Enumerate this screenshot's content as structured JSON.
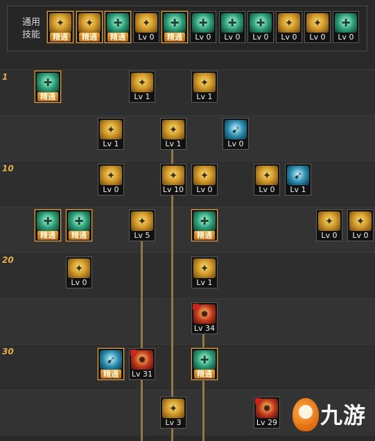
{
  "common": {
    "label_line1": "通用",
    "label_line2": "技能",
    "skills": [
      {
        "icon": "sit-fighter-icon",
        "color": "gold",
        "level": "精通",
        "mastered": true
      },
      {
        "icon": "crouch-fighter-icon",
        "color": "gold",
        "level": "精通",
        "mastered": true
      },
      {
        "icon": "dash-fighter-icon",
        "color": "teal",
        "level": "精通",
        "mastered": true
      },
      {
        "icon": "wings-icon",
        "color": "gold",
        "level": "Lv 0",
        "mastered": false
      },
      {
        "icon": "target-icon",
        "color": "teal",
        "level": "精通",
        "mastered": true
      },
      {
        "icon": "crosshair-icon",
        "color": "teal",
        "level": "Lv 0",
        "mastered": false
      },
      {
        "icon": "shout-icon",
        "color": "teal",
        "level": "Lv 0",
        "mastered": false
      },
      {
        "icon": "gear-head-icon",
        "color": "teal",
        "level": "Lv 0",
        "mastered": false
      },
      {
        "icon": "eye-swirl-icon",
        "color": "gold",
        "level": "Lv 0",
        "mastered": false
      },
      {
        "icon": "power-up-icon",
        "color": "gold",
        "level": "Lv 0",
        "mastered": false
      },
      {
        "icon": "leap-icon",
        "color": "teal",
        "level": "Lv 0",
        "mastered": false
      }
    ]
  },
  "tree": {
    "level_labels": [
      {
        "text": "1",
        "row": 0
      },
      {
        "text": "10",
        "row": 2
      },
      {
        "text": "20",
        "row": 4
      },
      {
        "text": "30",
        "row": 6
      }
    ],
    "skills": [
      {
        "icon": "cross-blades-icon",
        "color": "teal",
        "level": "精通",
        "mastered": true
      },
      {
        "icon": "boomerang-icon",
        "color": "gold",
        "level": "Lv 1",
        "mastered": false
      },
      {
        "icon": "kick-icon",
        "color": "gold",
        "level": "Lv 1",
        "mastered": false
      },
      {
        "icon": "burst-icon",
        "color": "gold",
        "level": "Lv 1",
        "mastered": false
      },
      {
        "icon": "shotgun-blast-icon",
        "color": "gold",
        "level": "Lv 1",
        "mastered": false
      },
      {
        "icon": "gun-icon",
        "color": "cyan",
        "level": "Lv 0",
        "mastered": false
      },
      {
        "icon": "fire-slash-icon",
        "color": "gold",
        "level": "Lv 0",
        "mastered": false
      },
      {
        "icon": "explosion-icon",
        "color": "gold",
        "level": "Lv 10",
        "mastered": false
      },
      {
        "icon": "stab-icon",
        "color": "gold",
        "level": "Lv 0",
        "mastered": false
      },
      {
        "icon": "upload-icon",
        "color": "gold",
        "level": "Lv 0",
        "mastered": false
      },
      {
        "icon": "spread-arrow-icon",
        "color": "cyan",
        "level": "Lv 1",
        "mastered": false
      },
      {
        "icon": "rifle-icon",
        "color": "teal",
        "level": "精通",
        "mastered": true
      },
      {
        "icon": "drill-icon",
        "color": "teal",
        "level": "精通",
        "mastered": true
      },
      {
        "icon": "cannon-icon",
        "color": "gold",
        "level": "Lv 5",
        "mastered": false
      },
      {
        "icon": "blade-icon",
        "color": "teal",
        "level": "精通",
        "mastered": true
      },
      {
        "icon": "axe-icon",
        "color": "gold",
        "level": "Lv 0",
        "mastered": false
      },
      {
        "icon": "grenade-icon",
        "color": "gold",
        "level": "Lv 0",
        "mastered": false
      },
      {
        "icon": "fist-beam-icon",
        "color": "gold",
        "level": "Lv 0",
        "mastered": false
      },
      {
        "icon": "eye-blast-icon",
        "color": "gold",
        "level": "Lv 1",
        "mastered": false
      },
      {
        "icon": "heavy-cannon-icon",
        "color": "red",
        "level": "Lv 34",
        "mastered": false
      },
      {
        "icon": "plasma-rifle-icon",
        "color": "cyan",
        "level": "精通",
        "mastered": true
      },
      {
        "icon": "laser-gun-icon",
        "color": "red",
        "level": "Lv 31",
        "mastered": false
      },
      {
        "icon": "radar-icon",
        "color": "teal",
        "level": "精通",
        "mastered": true
      },
      {
        "icon": "missile-icon",
        "color": "gold",
        "level": "Lv 3",
        "mastered": false
      },
      {
        "icon": "dragon-icon",
        "color": "red",
        "level": "Lv 29",
        "mastered": false
      }
    ]
  },
  "watermark": {
    "text": "九游"
  }
}
